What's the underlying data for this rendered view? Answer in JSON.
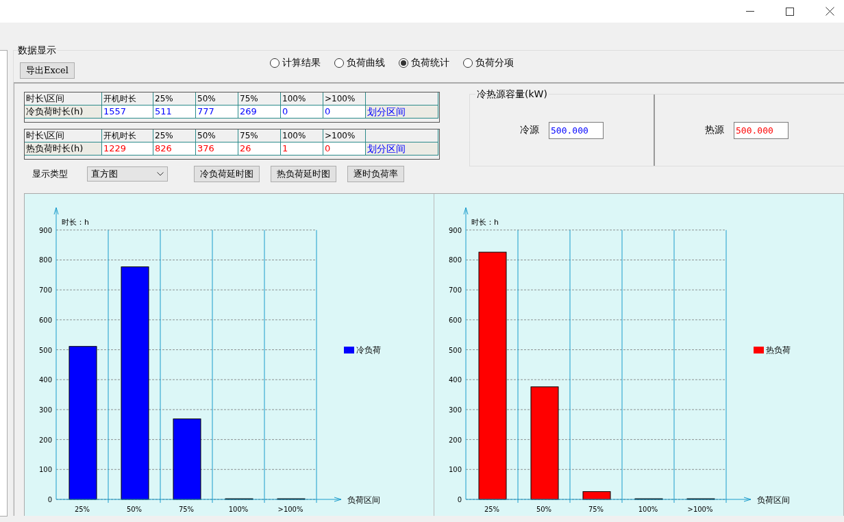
{
  "group": {
    "title": "数据显示"
  },
  "export_button": "导出Excel",
  "view_options": [
    {
      "label": "计算结果",
      "selected": false
    },
    {
      "label": "负荷曲线",
      "selected": false
    },
    {
      "label": "负荷统计",
      "selected": true
    },
    {
      "label": "负荷分项",
      "selected": false
    }
  ],
  "tables": [
    {
      "color": "#0000ff",
      "columns": [
        "时长\\区间",
        "开机时长",
        "25%",
        "50%",
        "75%",
        "100%",
        ">100%"
      ],
      "row_label": "冷负荷时长(h)",
      "values": [
        "1557",
        "511",
        "777",
        "269",
        "0",
        "0"
      ],
      "link": "划分区间"
    },
    {
      "color": "#ff0000",
      "columns": [
        "时长\\区间",
        "开机时长",
        "25%",
        "50%",
        "75%",
        "100%",
        ">100%"
      ],
      "row_label": "热负荷时长(h)",
      "values": [
        "1229",
        "826",
        "376",
        "26",
        "1",
        "0"
      ],
      "link": "划分区间"
    }
  ],
  "capacity": {
    "title": "冷热源容量(kW)",
    "sources": [
      {
        "label": "冷源",
        "value": "500.000",
        "color": "#0000ff"
      },
      {
        "label": "热源",
        "value": "500.000",
        "color": "#ff0000"
      }
    ]
  },
  "display_type": {
    "label": "显示类型",
    "value": "直方图"
  },
  "chart_buttons": [
    "冷负荷延时图",
    "热负荷延时图",
    "逐时负荷率"
  ],
  "charts": [
    {
      "chart_data": {
        "type": "bar",
        "ylabel": "时长：h",
        "xlabel": "负荷区间",
        "categories": [
          "25%",
          "50%",
          "75%",
          "100%",
          ">100%"
        ],
        "series": [
          {
            "name": "冷负荷",
            "color": "#0000ff",
            "values": [
              511,
              777,
              269,
              0,
              0
            ]
          }
        ],
        "grid": true,
        "ylim": [
          0,
          975
        ],
        "yticks": [
          0,
          100,
          200,
          300,
          400,
          500,
          600,
          700,
          800,
          900
        ]
      }
    },
    {
      "chart_data": {
        "type": "bar",
        "ylabel": "时长：h",
        "xlabel": "负荷区间",
        "categories": [
          "25%",
          "50%",
          "75%",
          "100%",
          ">100%"
        ],
        "series": [
          {
            "name": "热负荷",
            "color": "#ff0000",
            "values": [
              826,
              376,
              26,
              1,
              0
            ]
          }
        ],
        "grid": true,
        "ylim": [
          0,
          975
        ],
        "yticks": [
          0,
          100,
          200,
          300,
          400,
          500,
          600,
          700,
          800,
          900
        ]
      }
    }
  ]
}
